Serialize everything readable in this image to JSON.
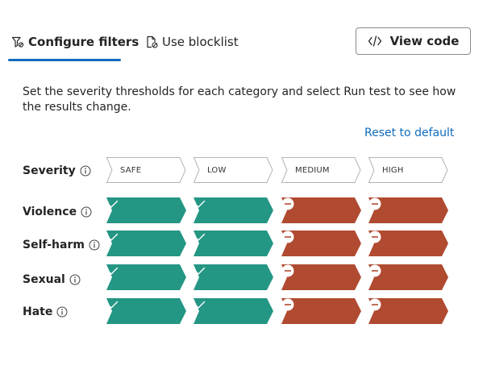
{
  "tabs": [
    {
      "label": "Configure filters",
      "icon": "filter-icon",
      "active": true
    },
    {
      "label": "Use blocklist",
      "icon": "blocklist-icon",
      "active": false
    }
  ],
  "view_code": {
    "label": "View code",
    "icon": "code-icon"
  },
  "description": "Set the severity thresholds for each category and select Run test to see how the results change.",
  "reset_label": "Reset to default",
  "severity": {
    "label": "Severity",
    "levels": [
      "SAFE",
      "LOW",
      "MEDIUM",
      "HIGH"
    ]
  },
  "categories": [
    {
      "label": "Violence",
      "states": [
        "allowed",
        "allowed",
        "blocked",
        "blocked"
      ]
    },
    {
      "label": "Self-harm",
      "states": [
        "allowed",
        "allowed",
        "blocked",
        "blocked"
      ]
    },
    {
      "label": "Sexual",
      "states": [
        "allowed",
        "allowed",
        "blocked",
        "blocked"
      ]
    },
    {
      "label": "Hate",
      "states": [
        "allowed",
        "allowed",
        "blocked",
        "blocked"
      ]
    }
  ],
  "colors": {
    "accent": "#0f6cbd",
    "allowed": "#249684",
    "blocked": "#b04a30",
    "header_border": "#b3b3b3"
  }
}
